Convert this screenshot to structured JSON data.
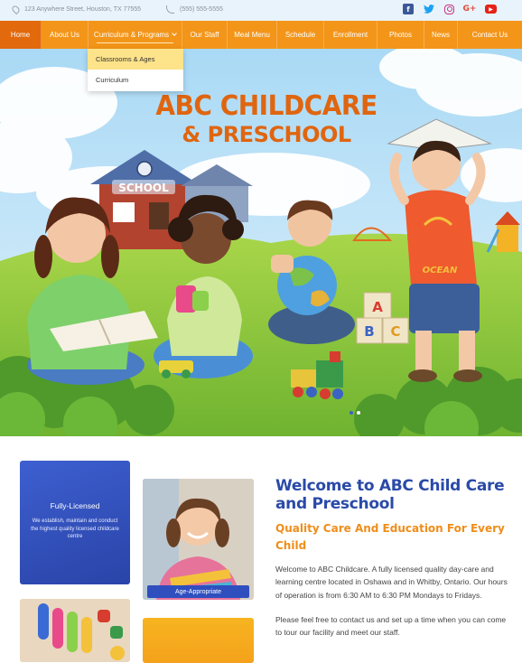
{
  "topbar": {
    "address": "123 Anywhere Street, Houston, TX 77555",
    "phone": "(555) 555-5555",
    "social": [
      "facebook-icon",
      "twitter-icon",
      "instagram-icon",
      "google-plus-icon",
      "youtube-icon"
    ]
  },
  "nav": {
    "items": [
      {
        "label": "Home"
      },
      {
        "label": "About Us"
      },
      {
        "label": "Curriculum & Programs"
      },
      {
        "label": "Our Staff"
      },
      {
        "label": "Meal Menu"
      },
      {
        "label": "Schedule"
      },
      {
        "label": "Enrollment"
      },
      {
        "label": "Photos"
      },
      {
        "label": "News"
      },
      {
        "label": "Contact Us"
      }
    ],
    "dropdown": [
      {
        "label": "Classrooms & Ages"
      },
      {
        "label": "Curriculum"
      }
    ]
  },
  "hero": {
    "title_line1": "ABC CHILDCARE",
    "title_line2": "& PRESCHOOL",
    "school_sign": "SCHOOL",
    "shirt_text": "OCEAN",
    "blocks": [
      "A",
      "B",
      "C"
    ]
  },
  "cards": {
    "licensed_title": "Fully-Licensed",
    "licensed_text": "We establish, maintain and conduct the highest quality licensed childcare centre",
    "photo_badge": "Age-Appropriate"
  },
  "welcome": {
    "title": "Welcome to ABC Child Care and Preschool",
    "subtitle": "Quality Care And Education For Every Child",
    "para1": "Welcome to ABC Childcare. A fully licensed quality day-care and learning centre located in Oshawa and in Whitby, Ontario. Our hours of operation is from 6:30 AM to 6:30 PM Mondays to Fridays.",
    "para2": "Please feel free to contact us and set up a time when you can come to tour our facility and meet our staff."
  },
  "colors": {
    "nav_orange": "#f39519",
    "nav_active": "#e2690c",
    "heading_blue": "#2a4aa8",
    "accent_orange": "#ef8d1a"
  }
}
